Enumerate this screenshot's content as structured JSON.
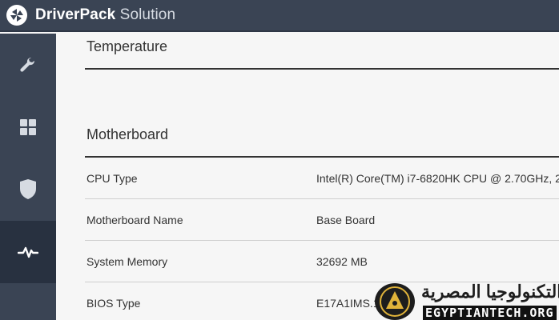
{
  "app": {
    "brand_bold": "DriverPack",
    "brand_light": " Solution"
  },
  "sidebar": {
    "items": [
      {
        "icon": "wrench-icon"
      },
      {
        "icon": "grid-icon"
      },
      {
        "icon": "shield-icon"
      },
      {
        "icon": "pulse-icon",
        "active": true
      }
    ]
  },
  "sections": {
    "temperature": {
      "title": "Temperature"
    },
    "motherboard": {
      "title": "Motherboard",
      "rows": [
        {
          "label": "CPU Type",
          "value": "Intel(R) Core(TM) i7-6820HK CPU @ 2.70GHz, 2"
        },
        {
          "label": "Motherboard Name",
          "value": "Base Board"
        },
        {
          "label": "System Memory",
          "value": "32692 MB"
        },
        {
          "label": "BIOS Type",
          "value": "E17A1IMS.10"
        }
      ]
    }
  },
  "watermark": {
    "arabic": "التكنولوجيا المصرية",
    "latin": "EGYPTIANTECH.ORG",
    "emblem_text": "EGYPTIAN"
  },
  "colors": {
    "titlebar": "#3a4454",
    "sidebar": "#3a4454",
    "sidebar_active": "#283140",
    "content_bg": "#f6f6f6"
  }
}
